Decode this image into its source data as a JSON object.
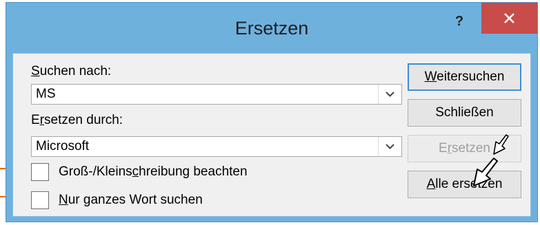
{
  "dialog": {
    "title": "Ersetzen",
    "help_label": "?"
  },
  "find": {
    "label_key": "S",
    "label_rest": "uchen nach:",
    "value": "MS"
  },
  "replace": {
    "label_pre": "E",
    "label_key": "r",
    "label_rest": "setzen durch:",
    "value": "Microsoft"
  },
  "options": {
    "match_case_pre": "Groß-/Kleins",
    "match_case_key": "c",
    "match_case_rest": "hreibung beachten",
    "match_case_checked": false,
    "whole_word_key": "N",
    "whole_word_rest": "ur ganzes Wort suchen",
    "whole_word_checked": false
  },
  "buttons": {
    "find_next_key": "W",
    "find_next_rest": "eitersuchen",
    "close": "Schließen",
    "replace_pre": "E",
    "replace_key": "r",
    "replace_rest": "setzen",
    "replace_all_key": "A",
    "replace_all_rest": "lle ersetzen"
  },
  "colors": {
    "accent_border": "#3c8fd6",
    "close_button": "#c74c4a",
    "annotation_arrow": "#e36c0a",
    "frame": "#6fb1dd"
  }
}
